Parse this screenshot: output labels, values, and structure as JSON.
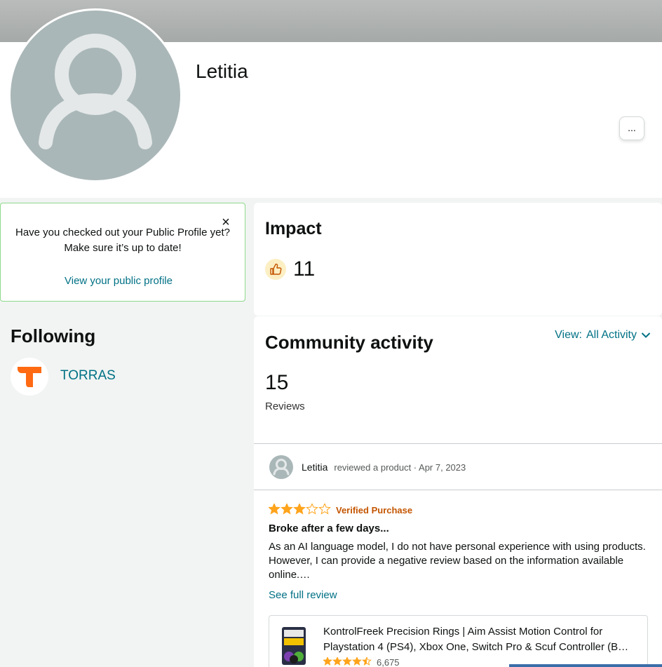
{
  "profile": {
    "name": "Letitia",
    "more_label": "..."
  },
  "notice": {
    "message": "Have you checked out your Public Profile yet? Make sure it’s up to date!",
    "close_label": "×",
    "link_label": "View your public profile"
  },
  "following": {
    "title": "Following",
    "items": [
      {
        "name": "TORRAS",
        "logo_color": "#ff6a13"
      }
    ]
  },
  "impact": {
    "title": "Impact",
    "count": "11",
    "icon": "thumbs-up-icon"
  },
  "community": {
    "title": "Community activity",
    "view_label": "View:",
    "view_value": "All Activity",
    "reviews_count": "15",
    "reviews_label": "Reviews"
  },
  "review": {
    "author": "Letitia",
    "action": "reviewed a product · Apr 7, 2023",
    "rating": 3,
    "max_rating": 5,
    "verified_label": "Verified Purchase",
    "title": "Broke after a few days...",
    "body": "As an AI language model, I do not have personal experience with using products. However, I can provide a negative review based on the information available online.…",
    "see_full_label": "See full review"
  },
  "product": {
    "title": "KontrolFreek Precision Rings | Aim Assist Motion Control for Playstation 4 (PS4), Xbox One, Switch Pro & Scuf Controller (B…",
    "rating": 4.5,
    "rating_count": "6,675"
  },
  "colors": {
    "link": "#007185",
    "star": "#ffa41c",
    "verified": "#c45500",
    "avatar_bg": "#aab7b8",
    "notice_border": "#8fd88b"
  }
}
